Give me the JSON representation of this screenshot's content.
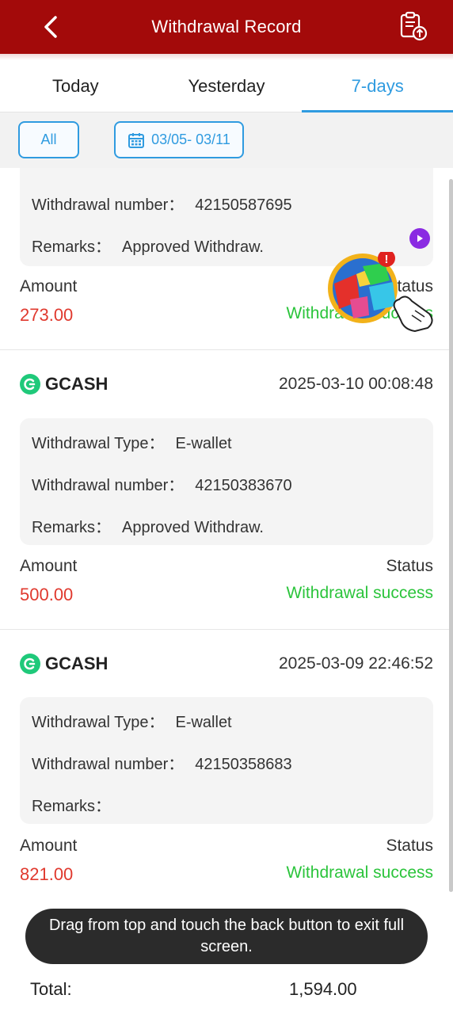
{
  "header": {
    "title": "Withdrawal Record",
    "back_icon": "chevron-left-icon",
    "record_icon": "clipboard-upload-icon"
  },
  "tabs": [
    {
      "label": "Today",
      "active": false
    },
    {
      "label": "Yesterday",
      "active": false
    },
    {
      "label": "7-days",
      "active": true
    }
  ],
  "filter": {
    "all_label": "All",
    "date_range": "03/05- 03/11",
    "date_icon": "calendar-icon"
  },
  "records": [
    {
      "method": "",
      "time": "",
      "details": [
        {
          "label": "Withdrawal number：",
          "value": "42150587695"
        },
        {
          "label": "Remarks：",
          "value": "Approved Withdraw."
        }
      ],
      "amount_label": "Amount",
      "amount": "273.00",
      "status_label": "Status",
      "status": "Withdrawal success"
    },
    {
      "method": "GCASH",
      "time": "2025-03-10 00:08:48",
      "details": [
        {
          "label": "Withdrawal Type：",
          "value": "E-wallet"
        },
        {
          "label": "Withdrawal number：",
          "value": "42150383670"
        },
        {
          "label": "Remarks：",
          "value": "Approved Withdraw."
        }
      ],
      "amount_label": "Amount",
      "amount": "500.00",
      "status_label": "Status",
      "status": "Withdrawal success"
    },
    {
      "method": "GCASH",
      "time": "2025-03-09 22:46:52",
      "details": [
        {
          "label": "Withdrawal Type：",
          "value": "E-wallet"
        },
        {
          "label": "Withdrawal number：",
          "value": "42150358683"
        },
        {
          "label": "Remarks：",
          "value": ""
        }
      ],
      "amount_label": "Amount",
      "amount": "821.00",
      "status_label": "Status",
      "status": "Withdrawal success"
    }
  ],
  "toast": "Drag from top and touch the back button to exit full screen.",
  "footer": {
    "total_label": "Total:",
    "total_value": "1,594.00"
  },
  "colors": {
    "header_bg": "#a30a0a",
    "accent": "#2f9be0",
    "amount": "#e0392e",
    "success": "#2bc43b"
  }
}
